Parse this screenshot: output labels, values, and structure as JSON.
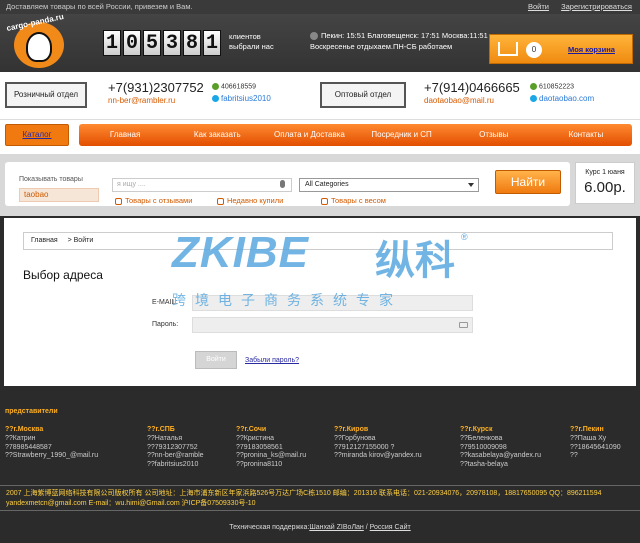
{
  "topbar": {
    "text": "Доставляем товары по всей России, привезем и Вам.",
    "login": "Войти",
    "register": "Зарегистрироваться"
  },
  "header": {
    "logo_text": "cargo-panda.ru",
    "counter_digits": [
      "1",
      "0",
      "5",
      "3",
      "8",
      "1"
    ],
    "counter_label": "клиентов выбрали нас",
    "time_line": "Пекин: 15:51 Благовещенск: 17:51 Москва:11:51",
    "schedule": "Воскресенье отдыхаем.ПН-СБ работаем",
    "cart_count": "0",
    "cart_label": "Моя корзина"
  },
  "contacts": {
    "retail_button": "Розничный отдел",
    "retail_phone": "+7(931)2307752",
    "retail_email": "nn-ber@rambler.ru",
    "retail_qq": "406618559",
    "retail_skype": "fabritsius2010",
    "wholesale_button": "Оптовый отдел",
    "wholesale_phone": "+7(914)0466665",
    "wholesale_email": "daotaobao@mail.ru",
    "wholesale_qq": "610852223",
    "wholesale_skype": "daotaobao.com"
  },
  "nav": {
    "catalog": "Каталог",
    "items": [
      "Главная",
      "Как заказать",
      "Оплата и Доставка",
      "Посредник и СП",
      "Отзывы",
      "Контакты"
    ]
  },
  "search": {
    "label": "Показывать товары",
    "source": "taobao",
    "placeholder": "я ищу ....",
    "category": "All Categories",
    "filter_reviews": "Товары с отзывами",
    "filter_recent": "Недавно купили",
    "filter_weight": "Товары с весом",
    "button": "Найти",
    "rate_label": "Курс 1 юаня",
    "rate_value": "6.00р."
  },
  "main": {
    "crumb_home": "Главная",
    "crumb_current": "> Войти",
    "title": "Выбор адреса",
    "email_label": "E-MAIL:",
    "password_label": "Пароль:",
    "login_button": "Войти",
    "forgot": "Забыли пароль?"
  },
  "watermark": {
    "brand": "ZKIBE",
    "cn": "纵科",
    "reg": "®",
    "sub": "跨境电子商务系统专家"
  },
  "footer": {
    "reps_title": "представители",
    "reps": [
      {
        "city": "??г.Москва",
        "name": "??Катрин",
        "phone": "?78985448587",
        "mail": "??Strawberry_1990_@mail.ru"
      },
      {
        "city": "??г.СПБ",
        "name": "??Наталья",
        "phone": "??79312307752",
        "mail": "??nn-ber@ramble",
        "extra": "??fabritsius2010"
      },
      {
        "city": "??г.Сочи",
        "name": "??Кристина",
        "phone": "?79183058561",
        "mail": "??pronina_ks@mail.ru",
        "extra": "??pronina8110"
      },
      {
        "city": "??г.Киров",
        "name": "??Горбунова",
        "phone": "?7912127155000 ?",
        "mail": "??mirandа kirov@yandex.ru"
      },
      {
        "city": "??г.Курск",
        "name": "??Беленкова",
        "phone": "?79510009098",
        "mail": "??kasabelaya@yandex.ru",
        "extra": "??tasha-belaya"
      },
      {
        "city": "??г.Пекин",
        "name": "??Паша Ху",
        "phone": "??18645641090",
        "mail": "??"
      }
    ],
    "copyright_line1": "2007 上海紫博蓝网络科技有限公司版权所有 公司地址：上海市浦东新区年家浜路526号万达广场C栋1510 邮编：201316 联系电话：021-20934076，20978108，18817650095 QQ：896211594",
    "copyright_line2": "yandexmetcn@gmail.com E-mail：wu.himi@Gmail.com 沪ICP备07509330号-10",
    "support_prefix": "Техническая поддержка:",
    "support_link1": "Шанхай ZIBoЛан",
    "support_sep": " / ",
    "support_link2": "Россия Сайт"
  }
}
